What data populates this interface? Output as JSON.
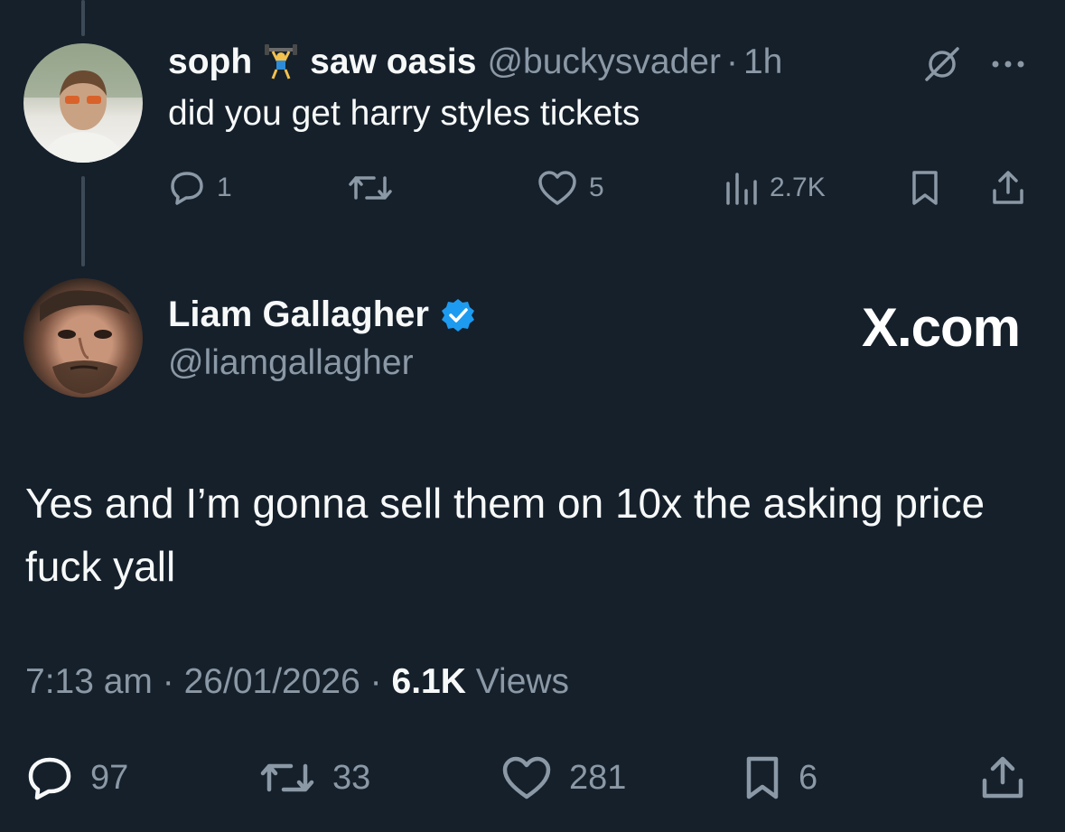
{
  "reply_tweet": {
    "display_name": "soph",
    "emoji": "weightlifter-emoji",
    "name_suffix": "saw oasis",
    "handle": "@buckysvader",
    "separator": "·",
    "time": "1h",
    "text": "did you get harry styles tickets",
    "actions": {
      "replies": "1",
      "reposts": "",
      "likes": "5",
      "views": "2.7K"
    }
  },
  "main_tweet": {
    "display_name": "Liam Gallagher",
    "handle": "@liamgallagher",
    "verified": true,
    "text": "Yes and I’m gonna sell them on 10x the asking price fuck yall",
    "time": "7:13 am",
    "date": "26/01/2026",
    "separator": "·",
    "views_count": "6.1K",
    "views_label": "Views",
    "actions": {
      "replies": "97",
      "reposts": "33",
      "likes": "281",
      "bookmarks": "6"
    }
  },
  "watermark": "X.com",
  "colors": {
    "background": "#15202b",
    "text": "#f7f9f9",
    "muted": "#8b98a5",
    "verified": "#1d9bf0",
    "thread_line": "#3d4a56"
  }
}
